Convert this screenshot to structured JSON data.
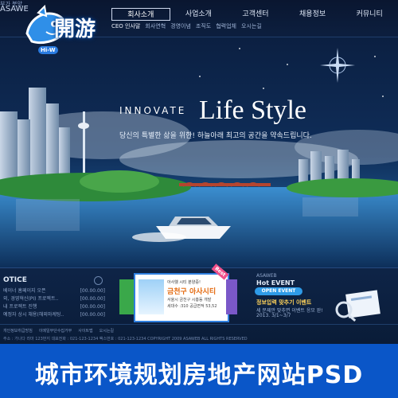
{
  "header": {
    "brand_mini": "부가 분양",
    "brand_small": "ASAWE",
    "logo_text": "開游",
    "logo_sub": "Hi-W",
    "nav": [
      "회사소개",
      "사업소개",
      "고객센터",
      "채용정보",
      "커뮤니티"
    ],
    "subnav": [
      "CEO 인사말",
      "회사연혁",
      "경영이념",
      "조직도",
      "협력업체",
      "오시는길"
    ]
  },
  "hero": {
    "innovate": "INNOVATE",
    "life_style": "Life Style",
    "tagline": "당신의 특별한 삶을 위한! 하늘아래 최고의 공간을 약속드립니다."
  },
  "notice": {
    "title": "OTICE",
    "rows": [
      {
        "text": "베이너 홈페이지 오픈",
        "date": "[00.00.00]"
      },
      {
        "text": "외, 경영혁신(PI) 프로젝트..",
        "date": "[00.00.00]"
      },
      {
        "text": "내 프로젝트 진행",
        "date": "[00.00.00]"
      },
      {
        "text": "예정자 상시 채용(해외마케팅..",
        "date": "[00.00.00]"
      }
    ]
  },
  "banner": {
    "line1": "아사웰 시티 분양중!",
    "line2": "금천구 아사시티",
    "line3": "서울시 금천구 시흥동 개발",
    "line4": "세대수 :310 공급면적 53,52",
    "best": "Best"
  },
  "event": {
    "label": "ASAWEB",
    "title": "Hot EVENT",
    "pill": "OPEN EVENT",
    "line1": "정보입력 맞추기 이벤트",
    "line2": "세 문제만 맞추면 이벤트 응모 완!",
    "line3": "2013. 3/1~3/7"
  },
  "footer": {
    "links": [
      "개인정보취급방침",
      "이메일무단수집거부",
      "사이트맵",
      "오시는길"
    ],
    "address": "주소 : 가나다 라마 123번지 대표전화 : 021-123-1234 팩스번호 : 021-123-1234    COPYRIGHT 2009 ASAWEB ALL RIGHTS RESERVED"
  },
  "caption": "城市环境规划房地产网站PSD",
  "colors": {
    "caption_bg": "#0a56c8",
    "background": "#0b1e3b"
  }
}
